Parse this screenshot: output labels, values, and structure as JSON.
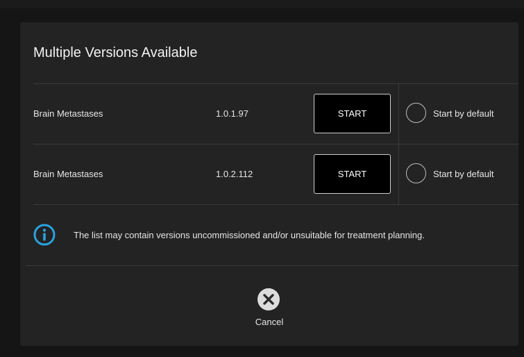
{
  "dialog": {
    "title": "Multiple Versions Available",
    "versions": [
      {
        "name": "Brain Metastases",
        "version": "1.0.1.97",
        "start_label": "START",
        "default_label": "Start by default",
        "default_selected": false
      },
      {
        "name": "Brain Metastases",
        "version": "1.0.2.112",
        "start_label": "START",
        "default_label": "Start by default",
        "default_selected": false
      }
    ],
    "info_icon": "info-circle-icon",
    "info_text": "The list may contain versions uncommissioned and/or unsuitable for treatment planning.",
    "cancel_icon": "close-circle-icon",
    "cancel_label": "Cancel"
  },
  "colors": {
    "accent": "#29a3e0",
    "dialog_background": "#232323",
    "backdrop": "#151515",
    "button_background": "#000000"
  }
}
